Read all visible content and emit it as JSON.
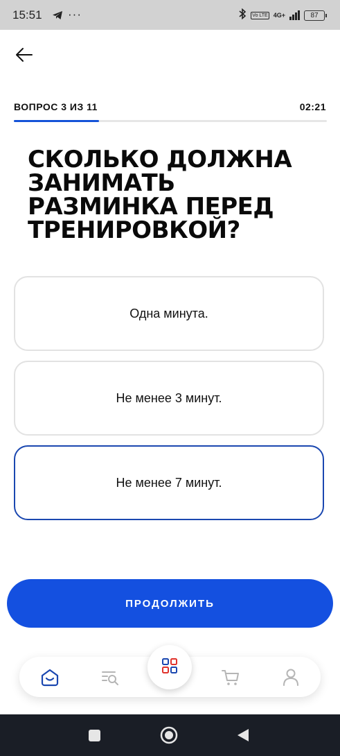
{
  "status_bar": {
    "time": "15:51",
    "dots": "···",
    "network": "4G+",
    "volte": "Vo LTE",
    "battery": "87"
  },
  "quiz": {
    "progress_label": "ВОПРОС 3 ИЗ 11",
    "current": 3,
    "total": 11,
    "timer": "02:21",
    "question": "СКОЛЬКО ДОЛЖНА ЗАНИМАТЬ РАЗМИНКА ПЕРЕД ТРЕНИРОВКОЙ?",
    "answers": [
      {
        "label": "Одна минута.",
        "selected": false
      },
      {
        "label": "Не менее 3 минут.",
        "selected": false
      },
      {
        "label": "Не менее 7 минут.",
        "selected": true
      }
    ],
    "continue_label": "ПРОДОЛЖИТЬ"
  },
  "tabbar": {
    "items": [
      "home-icon",
      "search-list-icon",
      "grid-icon",
      "cart-icon",
      "profile-icon"
    ],
    "active": "home-icon"
  },
  "colors": {
    "accent": "#1450e0",
    "selected_border": "#1a47b0",
    "grid_red": "#e0322b",
    "grid_blue": "#1a47b0"
  }
}
